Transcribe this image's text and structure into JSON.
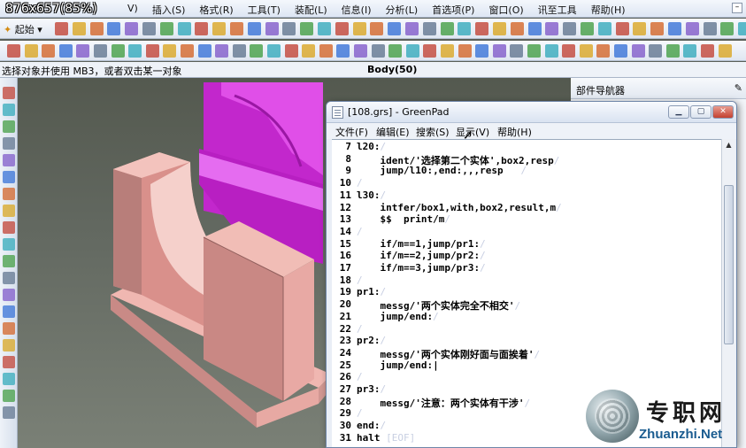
{
  "overlay": {
    "size_text": "876x657(85%)"
  },
  "host_menu": {
    "items": [
      "V)",
      "插入(S)",
      "格式(R)",
      "工具(T)",
      "装配(L)",
      "信息(I)",
      "分析(L)",
      "首选项(P)",
      "窗口(O)",
      "讯至工具",
      "帮助(H)"
    ]
  },
  "toolbar": {
    "start_label": "起始"
  },
  "status": {
    "prompt": "选择对象并使用 MB3，或者双击某一对象",
    "selection": "Body(50)"
  },
  "nav_panel": {
    "title": "部件导航器"
  },
  "greenpad": {
    "title": "[108.grs] - GreenPad",
    "menus": [
      "文件(F)",
      "编辑(E)",
      "搜索(S)",
      "显示(V)",
      "帮助(H)"
    ],
    "lines": [
      {
        "num": "7",
        "code": "l20:",
        "mark": "/"
      },
      {
        "num": "8",
        "code": "    ident/'选择第二个实体',box2,resp",
        "mark": "/"
      },
      {
        "num": "9",
        "code": "    jump/l10:,end:,,,resp",
        "mark": "   /"
      },
      {
        "num": "10",
        "code": "",
        "mark": "/"
      },
      {
        "num": "11",
        "code": "l30:",
        "mark": "/"
      },
      {
        "num": "12",
        "code": "    intfer/box1,with,box2,result,m",
        "mark": "/"
      },
      {
        "num": "13",
        "code": "    $$  print/m",
        "mark": "/"
      },
      {
        "num": "14",
        "code": "",
        "mark": "/"
      },
      {
        "num": "15",
        "code": "    if/m==1,jump/pr1:",
        "mark": "/"
      },
      {
        "num": "16",
        "code": "    if/m==2,jump/pr2:",
        "mark": "/"
      },
      {
        "num": "17",
        "code": "    if/m==3,jump/pr3:",
        "mark": "/"
      },
      {
        "num": "18",
        "code": "",
        "mark": "/"
      },
      {
        "num": "19",
        "code": "pr1:",
        "mark": "/"
      },
      {
        "num": "20",
        "code": "    messg/'两个实体完全不相交'",
        "mark": "/"
      },
      {
        "num": "21",
        "code": "    jump/end:",
        "mark": "/"
      },
      {
        "num": "22",
        "code": "",
        "mark": "/"
      },
      {
        "num": "23",
        "code": "pr2:",
        "mark": "/"
      },
      {
        "num": "24",
        "code": "    messg/'两个实体刚好面与面挨着'",
        "mark": "/"
      },
      {
        "num": "25",
        "code": "    jump/end:|",
        "mark": ""
      },
      {
        "num": "26",
        "code": "",
        "mark": "/"
      },
      {
        "num": "27",
        "code": "pr3:",
        "mark": "/"
      },
      {
        "num": "28",
        "code": "    messg/'注意：两个实体有干涉'",
        "mark": "/"
      },
      {
        "num": "29",
        "code": "",
        "mark": "/"
      },
      {
        "num": "30",
        "code": "end:",
        "mark": "/"
      },
      {
        "num": "31",
        "code": "halt ",
        "mark": "[EOF]"
      }
    ]
  },
  "watermark": {
    "cn": "专职网",
    "en": "Zhuanzhi.Net"
  },
  "colors": {
    "model_pink": "#e8a9a4",
    "model_magenta": "#d832e0",
    "viewport_bg": "#5c6258"
  }
}
